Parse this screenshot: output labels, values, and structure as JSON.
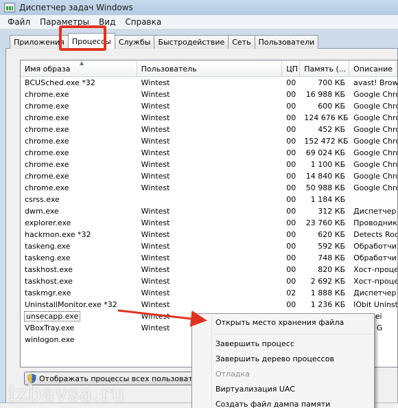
{
  "window": {
    "title": "Диспетчер задач Windows"
  },
  "menu": [
    "Файл",
    "Параметры",
    "Вид",
    "Справка"
  ],
  "tabs": [
    "Приложения",
    "Процессы",
    "Службы",
    "Быстродействие",
    "Сеть",
    "Пользователи"
  ],
  "active_tab": "Процессы",
  "columns": {
    "name": "Имя образа",
    "user": "Пользователь",
    "cpu": "ЦП",
    "mem": "Память (...",
    "desc": "Описание"
  },
  "processes": [
    {
      "name": "BCUSched.exe *32",
      "user": "Wintest",
      "cpu": "00",
      "mem": "700 КБ",
      "desc": "avast! Brow"
    },
    {
      "name": "chrome.exe",
      "user": "Wintest",
      "cpu": "00",
      "mem": "16 988 КБ",
      "desc": "Google Chro"
    },
    {
      "name": "chrome.exe",
      "user": "Wintest",
      "cpu": "00",
      "mem": "600 КБ",
      "desc": "Google Chro"
    },
    {
      "name": "chrome.exe",
      "user": "Wintest",
      "cpu": "00",
      "mem": "124 676 КБ",
      "desc": "Google Chro"
    },
    {
      "name": "chrome.exe",
      "user": "Wintest",
      "cpu": "00",
      "mem": "452 КБ",
      "desc": "Google Chro"
    },
    {
      "name": "chrome.exe",
      "user": "Wintest",
      "cpu": "00",
      "mem": "152 472 КБ",
      "desc": "Google Chro"
    },
    {
      "name": "chrome.exe",
      "user": "Wintest",
      "cpu": "00",
      "mem": "69 024 КБ",
      "desc": "Google Chro"
    },
    {
      "name": "chrome.exe",
      "user": "Wintest",
      "cpu": "00",
      "mem": "1 100 КБ",
      "desc": "Google Chro"
    },
    {
      "name": "chrome.exe",
      "user": "Wintest",
      "cpu": "00",
      "mem": "14 840 КБ",
      "desc": "Google Chro"
    },
    {
      "name": "chrome.exe",
      "user": "Wintest",
      "cpu": "00",
      "mem": "50 988 КБ",
      "desc": "Google Chro"
    },
    {
      "name": "csrss.exe",
      "user": "",
      "cpu": "00",
      "mem": "1 184 КБ",
      "desc": ""
    },
    {
      "name": "dwm.exe",
      "user": "Wintest",
      "cpu": "00",
      "mem": "312 КБ",
      "desc": "Диспетчер"
    },
    {
      "name": "explorer.exe",
      "user": "Wintest",
      "cpu": "00",
      "mem": "23 760 КБ",
      "desc": "Проводник"
    },
    {
      "name": "hackmon.exe *32",
      "user": "Wintest",
      "cpu": "00",
      "mem": "620 КБ",
      "desc": "Detects Roo"
    },
    {
      "name": "taskeng.exe",
      "user": "Wintest",
      "cpu": "00",
      "mem": "592 КБ",
      "desc": "Обработчи"
    },
    {
      "name": "taskeng.exe",
      "user": "Wintest",
      "cpu": "00",
      "mem": "748 КБ",
      "desc": "Обработчи"
    },
    {
      "name": "taskhost.exe",
      "user": "Wintest",
      "cpu": "00",
      "mem": "820 КБ",
      "desc": "Хост-процес"
    },
    {
      "name": "taskhost.exe",
      "user": "Wintest",
      "cpu": "00",
      "mem": "2 692 КБ",
      "desc": "Хост-проце"
    },
    {
      "name": "taskmgr.exe",
      "user": "Wintest",
      "cpu": "02",
      "mem": "1 888 КБ",
      "desc": "Диспетчер"
    },
    {
      "name": "UninstallMonitor.exe *32",
      "user": "Wintest",
      "cpu": "00",
      "mem": "1 236 КБ",
      "desc": "IObit Uninst"
    },
    {
      "name": "unsecapp.exe",
      "user": "Wintest",
      "cpu": "",
      "mem": "",
      "desc": "to recei"
    },
    {
      "name": "VBoxTray.exe",
      "user": "Wintest",
      "cpu": "",
      "mem": "",
      "desc": "alBox G"
    },
    {
      "name": "winlogon.exe",
      "user": "",
      "cpu": "",
      "mem": "",
      "desc": ""
    }
  ],
  "context_menu": {
    "open_location": "Открыть место хранения файла",
    "end_process": "Завершить процесс",
    "end_tree": "Завершить дерево процессов",
    "debug": "Отладка",
    "uac": "Виртуализация UAC",
    "dump": "Создать файл дампа памяти"
  },
  "show_all_button": "Отображать процессы всех пользователей",
  "watermark": "izbavsa.ru",
  "accent_color": "#e0331f"
}
